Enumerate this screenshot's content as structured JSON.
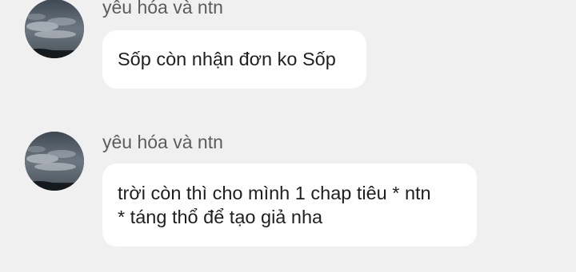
{
  "messages": [
    {
      "sender": "yêu hóa và ntn",
      "avatar_icon": "cloudy-sky-avatar",
      "text_lines": [
        "Sốp còn nhận đơn ko Sốp"
      ]
    },
    {
      "sender": "yêu hóa và ntn",
      "avatar_icon": "cloudy-sky-avatar",
      "text_lines": [
        "trời còn thì cho mình 1 chap tiêu * ntn",
        "* táng thổ để tạo giả nha"
      ]
    }
  ],
  "colors": {
    "background": "#f0f0f0",
    "bubble": "#ffffff",
    "sender_text": "#5c5c5c",
    "message_text": "#1f1f1f"
  }
}
